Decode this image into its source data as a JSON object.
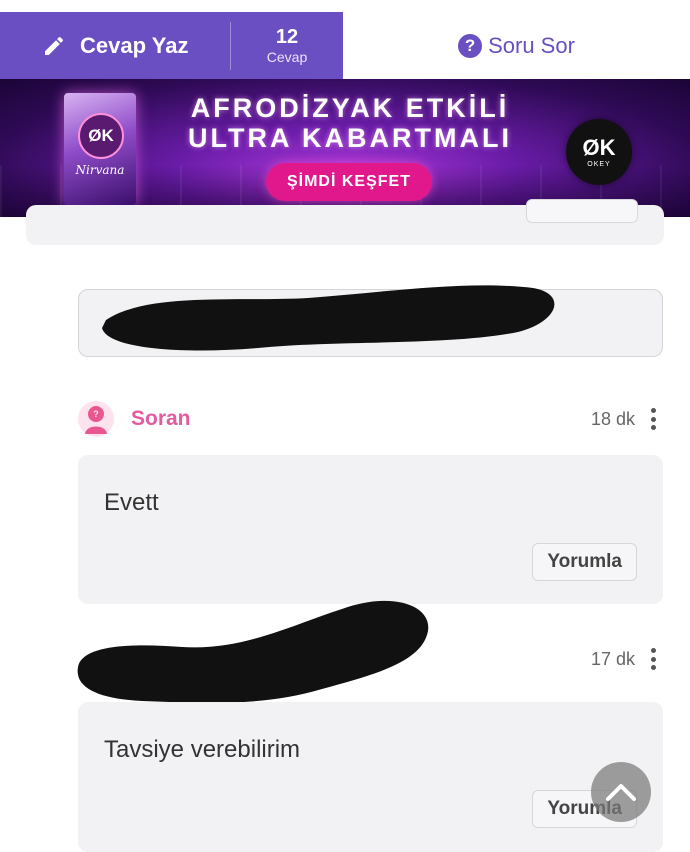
{
  "header": {
    "answer_label": "Cevap Yaz",
    "answer_count": "12",
    "answer_unit": "Cevap",
    "ask_label": "Soru Sor",
    "pen_icon": "pencil-icon",
    "question_icon": "question-circle-icon",
    "accent": "#6a4fc2"
  },
  "ad": {
    "headline_line1": "AFRODİZYAK ETKİLİ",
    "headline_line2": "ULTRA KABARTMALI",
    "cta": "ŞİMDİ KEŞFET",
    "pack_logo": "ØK",
    "pack_name": "Nirvana",
    "brand_logo": "ØK",
    "brand_sub": "OKEY",
    "cta_color": "#e0188c"
  },
  "posts": [
    {
      "author": "Soran",
      "time": "18 dk",
      "text": "Evett",
      "reply_label": "Yorumla"
    },
    {
      "author": "",
      "time": "17 dk",
      "text": "Tavsiye verebilirim",
      "reply_label": "Yorumla"
    }
  ],
  "colors": {
    "author": "#e45c9d",
    "card": "#f2f2f4"
  },
  "scroll_top_icon": "chevron-up-icon"
}
